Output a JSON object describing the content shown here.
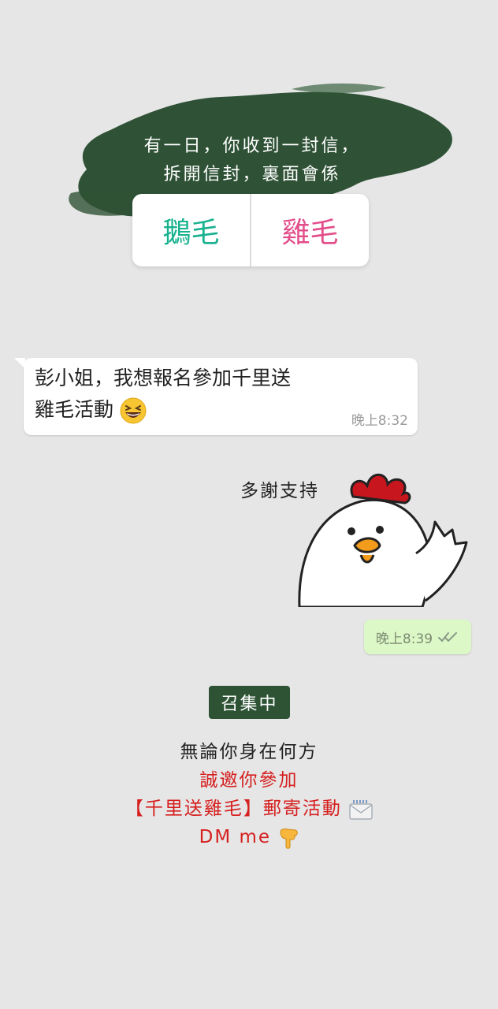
{
  "story": {
    "line1": "有一日，你收到一封信，",
    "line2": "拆開信封，裏面會係"
  },
  "poll": {
    "option1": "鵝毛",
    "option2": "雞毛",
    "option1_color": "#18b28f",
    "option2_color": "#e24d8a"
  },
  "chat": {
    "incoming": {
      "line1": "彭小姐，我想報名參加千里送",
      "line2": "雞毛活動",
      "emoji": "grinning-squinting-face-emoji",
      "time": "晚上8:32"
    },
    "sticker": {
      "caption": "多謝支持",
      "image": "waving-chicken-sticker"
    },
    "outgoing": {
      "time": "晚上8:39",
      "status_icon": "double-check-icon"
    }
  },
  "promo": {
    "badge": "召集中",
    "line1": "無論你身在何方",
    "line2": "誠邀你參加",
    "line3": "【千里送雞毛】郵寄活動",
    "line3_emoji": "envelope-emoji",
    "line4": "DM me",
    "line4_emoji": "pointing-down-emoji"
  },
  "colors": {
    "background": "#e6e6e6",
    "chalkboard": "#2f5236",
    "bubble_out": "#dcf8c6",
    "red_text": "#d61f1f"
  }
}
